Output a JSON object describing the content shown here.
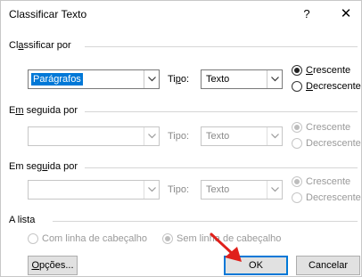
{
  "window": {
    "title": "Classificar Texto",
    "help": "?",
    "close": "✕"
  },
  "section1": {
    "label_pre": "Cl",
    "label_u": "a",
    "label_post": "ssificar por",
    "field": "Parágrafos",
    "tipo_pre": "Ti",
    "tipo_u": "p",
    "tipo_post": "o:",
    "type": "Texto",
    "asc_u": "C",
    "asc_rest": "rescente",
    "desc_u": "D",
    "desc_rest": "ecrescente",
    "selected": "Crescente"
  },
  "section2": {
    "label_pre": "E",
    "label_u": "m",
    "label_post": " seguida por",
    "field": "",
    "tipo_label": "Tipo:",
    "type": "Texto",
    "asc": "Crescente",
    "desc": "Decrescente"
  },
  "section3": {
    "label_pre": "Em seg",
    "label_u": "u",
    "label_post": "ida por",
    "field": "",
    "tipo_label": "Tipo:",
    "type": "Texto",
    "asc": "Crescente",
    "desc": "Decrescente"
  },
  "list": {
    "label": "A lista",
    "with_header": "Com linha de cabeçalho",
    "without_header": "Sem linha de cabeçalho",
    "selected": "Sem linha de cabeçalho"
  },
  "buttons": {
    "options_u": "O",
    "options_rest": "pções...",
    "ok": "OK",
    "cancel": "Cancelar"
  },
  "colors": {
    "selection": "#0078d7",
    "annotation_arrow": "#e0201b"
  }
}
